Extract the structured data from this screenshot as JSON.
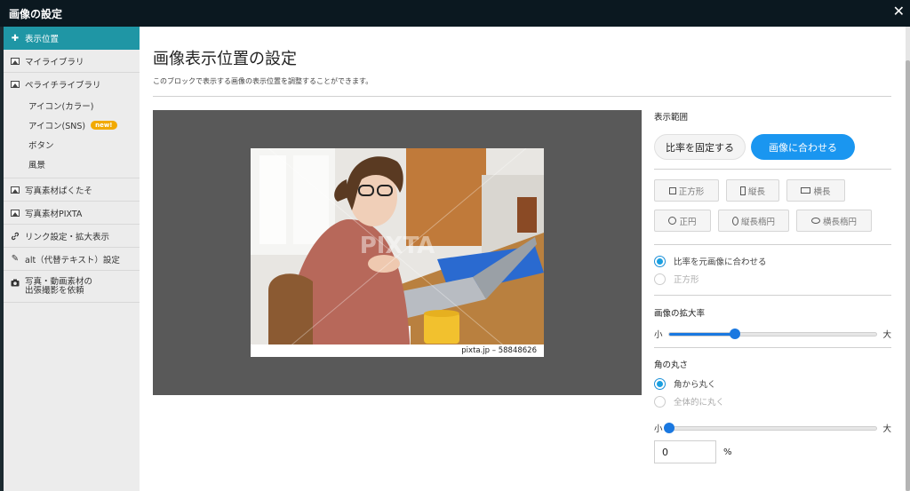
{
  "window": {
    "title": "画像の設定",
    "close_glyph": "✕"
  },
  "sidebar": {
    "items": [
      {
        "label": "表示位置",
        "active": true,
        "icon": "plus-icon"
      },
      {
        "label": "マイライブラリ",
        "icon": "image-icon"
      },
      {
        "label": "ペライチライブラリ",
        "icon": "image-icon",
        "subitems": [
          {
            "label": "アイコン(カラー)"
          },
          {
            "label": "アイコン(SNS)",
            "badge": "new!"
          },
          {
            "label": "ボタン"
          },
          {
            "label": "風景"
          }
        ]
      },
      {
        "label": "写真素材ぱくたそ",
        "icon": "image-icon"
      },
      {
        "label": "写真素材PIXTA",
        "icon": "image-icon"
      },
      {
        "label": "リンク設定・拡大表示",
        "icon": "link-icon"
      },
      {
        "label": "alt（代替テキスト）設定",
        "icon": "pencil-icon"
      },
      {
        "label_line1": "写真・動画素材の",
        "label_line2": "出張撮影を依頼",
        "icon": "camera-icon"
      }
    ]
  },
  "main": {
    "title": "画像表示位置の設定",
    "description": "このブロックで表示する画像の表示位置を調整することができます。",
    "preview": {
      "caption": "pixta.jp – 58848626",
      "watermark": "PIXTA"
    }
  },
  "panel": {
    "display_range": {
      "label": "表示範囲",
      "fixed_ratio": "比率を固定する",
      "fit_image": "画像に合わせる",
      "selected": "fit_image"
    },
    "shapes": {
      "row1": [
        "正方形",
        "縦長",
        "横長"
      ],
      "row2": [
        "正円",
        "縦長楕円",
        "横長楕円"
      ]
    },
    "ratio_options": {
      "options": [
        "比率を元画像に合わせる",
        "正方形"
      ],
      "selected": 0
    },
    "zoom": {
      "label": "画像の拡大率",
      "min_label": "小",
      "max_label": "大",
      "value_fraction": 0.32
    },
    "corner": {
      "label": "角の丸さ",
      "options": [
        "角から丸く",
        "全体的に丸く"
      ],
      "selected": 0,
      "min_label": "小",
      "max_label": "大",
      "value": "0",
      "unit": "%"
    }
  },
  "colors": {
    "accent": "#1a96f0",
    "active_tab": "#1f96a5",
    "badge": "#f2a900"
  }
}
